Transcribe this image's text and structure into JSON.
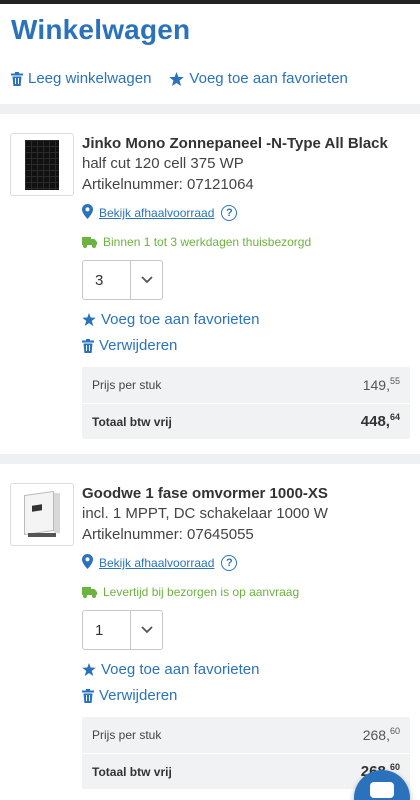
{
  "page": {
    "title": "Winkelwagen"
  },
  "actions": {
    "clear_cart": "Leeg winkelwagen",
    "add_favorites": "Voeg toe aan favorieten"
  },
  "colors": {
    "brand_blue": "#2a73bc",
    "green": "#6cb33f",
    "box_gray": "#f0f2f4"
  },
  "items": [
    {
      "name": "Jinko Mono Zonnepaneel -N-Type All Black",
      "line1": "half cut 120 cell 375 WP",
      "line2": "Artikelnummer: 07121064",
      "pickup_link": "Bekijk afhaalvoorraad",
      "help": "?",
      "delivery": "Binnen 1 tot 3 werkdagen thuisbezorgd",
      "quantity": "3",
      "favorite_label": "Voeg toe aan favorieten",
      "remove_label": "Verwijderen",
      "unit_price_label": "Prijs per stuk",
      "unit_price_main": "149,",
      "unit_price_cents": "55",
      "total_label": "Totaal btw vrij",
      "total_main": "448,",
      "total_cents": "64",
      "image_icon": "solar-panel-image"
    },
    {
      "name": "Goodwe 1 fase omvormer 1000-XS",
      "line1": "incl. 1 MPPT, DC schakelaar 1000 W",
      "line2": "Artikelnummer: 07645055",
      "pickup_link": "Bekijk afhaalvoorraad",
      "help": "?",
      "delivery": "Levertijd bij bezorgen is op aanvraag",
      "quantity": "1",
      "favorite_label": "Voeg toe aan favorieten",
      "remove_label": "Verwijderen",
      "unit_price_label": "Prijs per stuk",
      "unit_price_main": "268,",
      "unit_price_cents": "60",
      "total_label": "Totaal btw vrij",
      "total_main": "268,",
      "total_cents": "60",
      "image_icon": "inverter-image"
    }
  ]
}
